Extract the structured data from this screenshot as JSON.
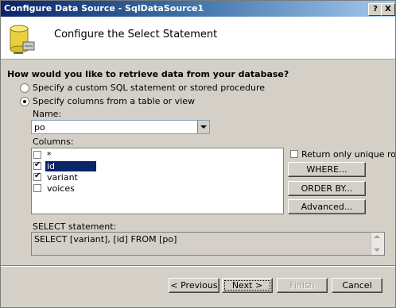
{
  "window": {
    "title": "Configure Data Source - SqlDataSource1",
    "help_btn": "?",
    "close_btn": "X"
  },
  "header": {
    "title": "Configure the Select Statement"
  },
  "question": "How would you like to retrieve data from your database?",
  "options": {
    "custom_sql": "Specify a custom SQL statement or stored procedure",
    "table_columns": "Specify columns from a table or view",
    "selected": "table_columns"
  },
  "name_label": "Name:",
  "name_value": "po",
  "columns_label": "Columns:",
  "columns": [
    {
      "label": "*",
      "checked": false,
      "selected": false
    },
    {
      "label": "id",
      "checked": true,
      "selected": true
    },
    {
      "label": "variant",
      "checked": true,
      "selected": false
    },
    {
      "label": "voices",
      "checked": false,
      "selected": false
    }
  ],
  "unique_rows_label": "Return only unique rows",
  "buttons": {
    "where": "WHERE...",
    "order_by": "ORDER BY...",
    "advanced": "Advanced..."
  },
  "select_label": "SELECT statement:",
  "select_statement": "SELECT [variant], [id] FROM [po]",
  "nav": {
    "previous": "< Previous",
    "next": "Next >",
    "finish": "Finish",
    "cancel": "Cancel"
  }
}
